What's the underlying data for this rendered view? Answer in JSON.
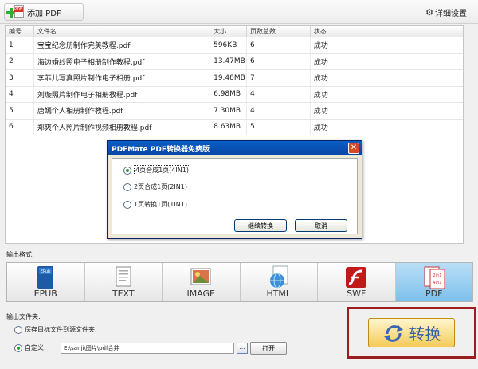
{
  "toolbar": {
    "add_pdf_label": "添加 PDF",
    "settings_label": "详细设置",
    "add_icon_badge": "PDF"
  },
  "table": {
    "headers": [
      "编号",
      "文件名",
      "大小",
      "页数总数",
      "状态"
    ],
    "rows": [
      [
        "1",
        "宝宝纪念册制作完美教程.pdf",
        "596KB",
        "6",
        "成功"
      ],
      [
        "2",
        "海边婚纱照电子相册制作教程.pdf",
        "13.47MB",
        "6",
        "成功"
      ],
      [
        "3",
        "李菲儿写真照片制作电子相册.pdf",
        "19.48MB",
        "7",
        "成功"
      ],
      [
        "4",
        "刘璇照片制作电子相册教程.pdf",
        "6.98MB",
        "4",
        "成功"
      ],
      [
        "5",
        "唐嫣个人相册制作教程.pdf",
        "7.30MB",
        "4",
        "成功"
      ],
      [
        "6",
        "郑爽个人照片制作视频相册教程.pdf",
        "8.63MB",
        "5",
        "成功"
      ]
    ]
  },
  "modal": {
    "title": "PDFMate PDF转换器免费版",
    "options": [
      "4页合成1页(4IN1)",
      "2页合成1页(2IN1)",
      "1页转换1页(1IN1)"
    ],
    "selected_option": 0,
    "continue_label": "继续转换",
    "cancel_label": "取消",
    "close_glyph": "✕"
  },
  "output_format": {
    "label": "输出格式:",
    "formats": [
      "EPUB",
      "TEXT",
      "IMAGE",
      "HTML",
      "SWF",
      "PDF"
    ],
    "selected": "PDF",
    "icon_labels": {
      "epub": "EPub",
      "pdf_thumbs": [
        "2in1",
        "4in1"
      ]
    }
  },
  "output_folder": {
    "label": "输出文件夹:",
    "option_source": "保存目标文件到源文件夹.",
    "option_custom": "自定义:",
    "selected": "custom",
    "path": "E:\\sanji\\图片\\pdf合并",
    "browse_label": "...",
    "open_label": "打开"
  },
  "convert": {
    "label": "转换"
  },
  "colors": {
    "accent_frame": "#9a1e1e",
    "selected_format_bg": "#7dc0ec",
    "modal_titlebar": "#0a5ec6"
  }
}
